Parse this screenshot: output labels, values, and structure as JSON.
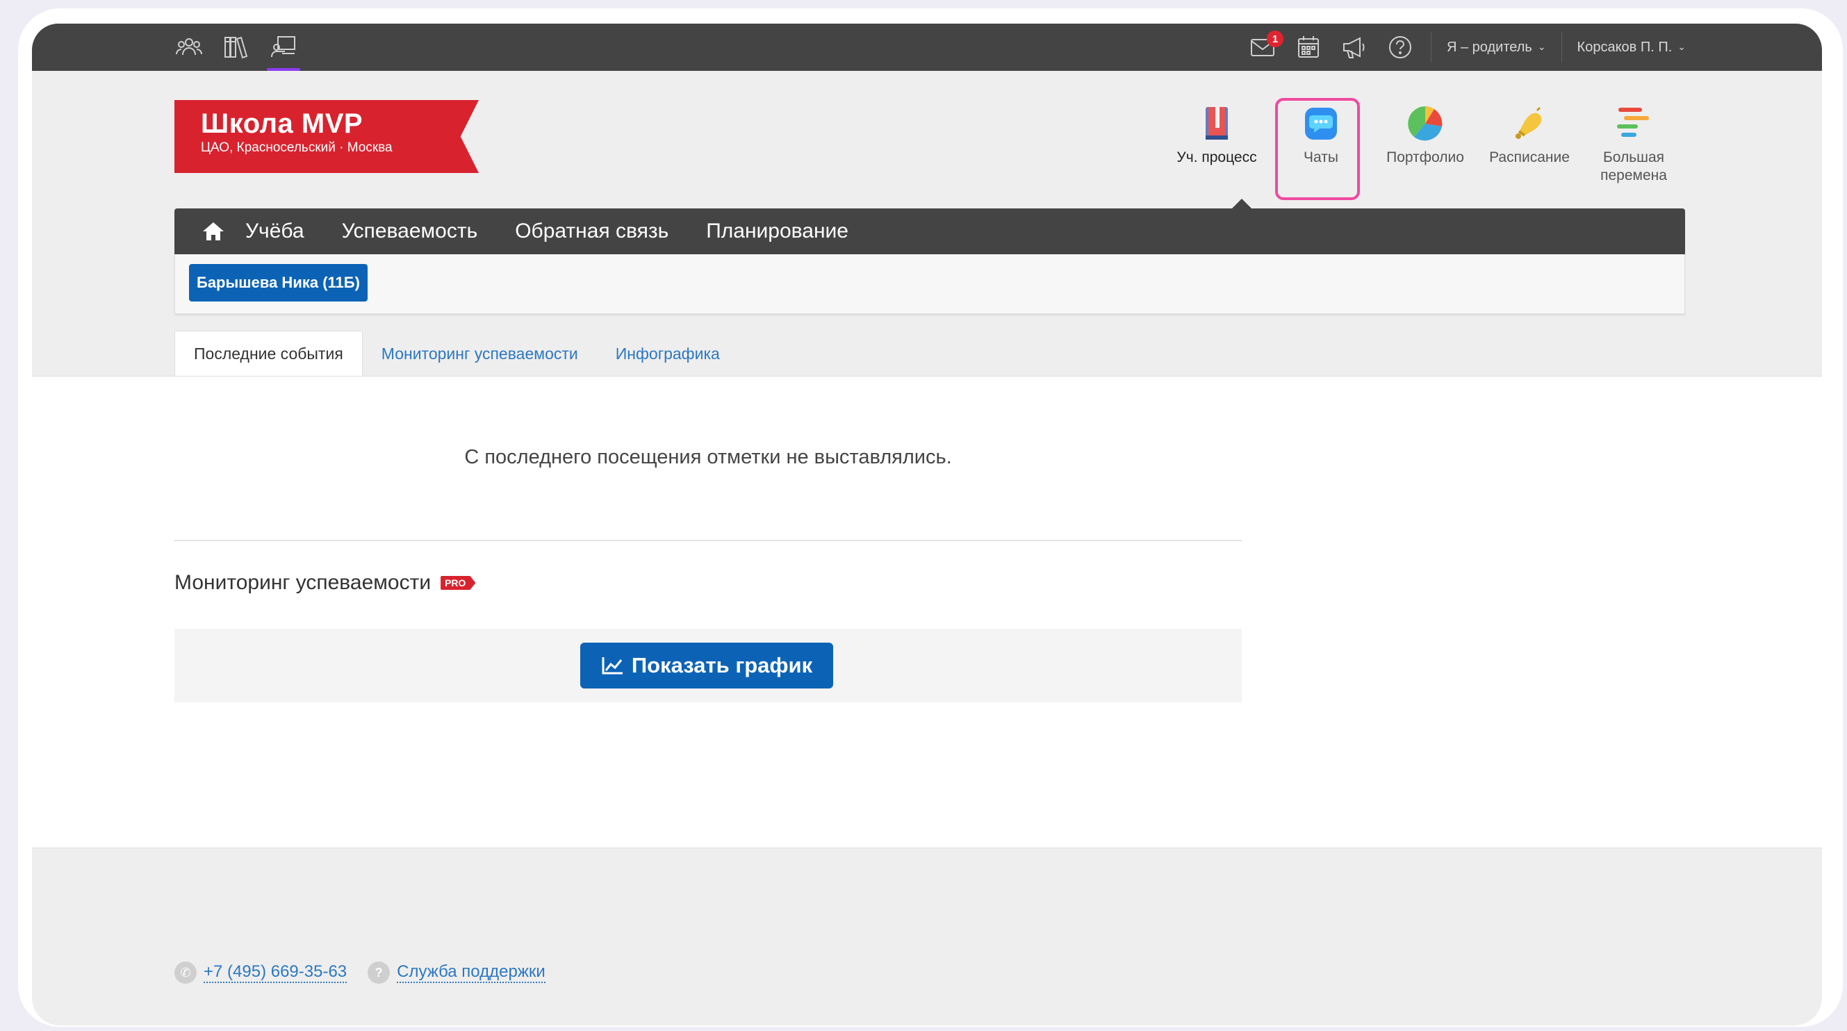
{
  "topbar": {
    "left_icons": [
      "people-icon",
      "library-icon",
      "classroom-icon"
    ],
    "mail_badge": "1",
    "role_label": "Я – родитель",
    "user_label": "Корсаков П. П."
  },
  "school": {
    "name": "Школа MVP",
    "location": "ЦАО, Красносельский · Москва"
  },
  "apps": [
    {
      "label": "Уч. процесс"
    },
    {
      "label": "Чаты"
    },
    {
      "label": "Портфолио"
    },
    {
      "label": "Расписание"
    },
    {
      "label": "Большая перемена"
    }
  ],
  "mainnav": {
    "items": [
      "Учёба",
      "Успеваемость",
      "Обратная связь",
      "Планирование"
    ]
  },
  "student": {
    "label": "Барышева Ника (11Б)"
  },
  "tabs": [
    "Последние события",
    "Мониторинг успеваемости",
    "Инфографика"
  ],
  "content": {
    "no_marks": "С последнего посещения отметки не выставлялись.",
    "monitor_title": "Мониторинг успеваемости",
    "pro_badge": "PRO",
    "show_graph": "Показать график"
  },
  "footer": {
    "phone": "+7 (495) 669-35-63",
    "support": "Служба поддержки"
  },
  "colors": {
    "accent_blue": "#0c63b6",
    "brand_red": "#d8232f",
    "highlight_pink": "#ef4aa0",
    "topbar": "#444444"
  }
}
